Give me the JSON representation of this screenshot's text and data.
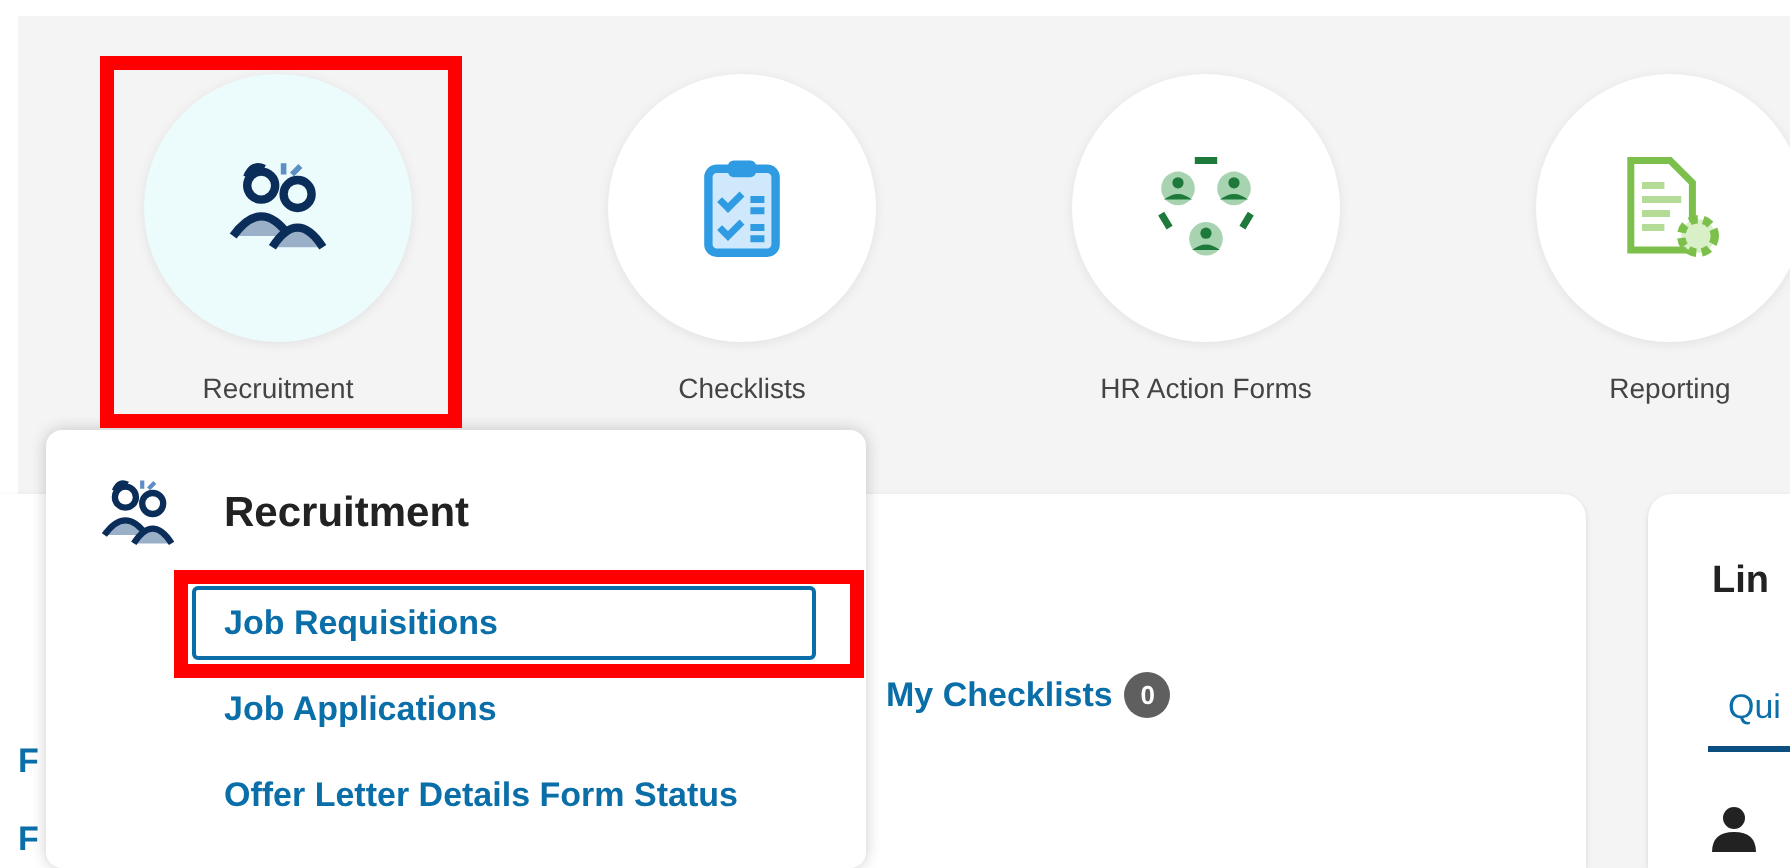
{
  "tiles": [
    {
      "label": "Recruitment",
      "kind": "recruitment",
      "selected": true,
      "highlighted": true
    },
    {
      "label": "Checklists",
      "kind": "checklist",
      "selected": false,
      "highlighted": false
    },
    {
      "label": "HR Action Forms",
      "kind": "team",
      "selected": false,
      "highlighted": false
    },
    {
      "label": "Reporting",
      "kind": "report",
      "selected": false,
      "highlighted": false
    }
  ],
  "left_fragments": [
    "F",
    "F"
  ],
  "checklists": {
    "label": "My Checklists",
    "count": "0"
  },
  "links_card": {
    "title": "Lin",
    "tabs": [
      {
        "label": "Qui",
        "selected": true
      }
    ]
  },
  "dropdown": {
    "title": "Recruitment",
    "items": [
      {
        "label": "Job Requisitions",
        "focused": true,
        "highlighted": true
      },
      {
        "label": "Job Applications",
        "focused": false,
        "highlighted": false
      },
      {
        "label": "Offer Letter Details Form Status",
        "focused": false,
        "highlighted": false
      }
    ]
  }
}
